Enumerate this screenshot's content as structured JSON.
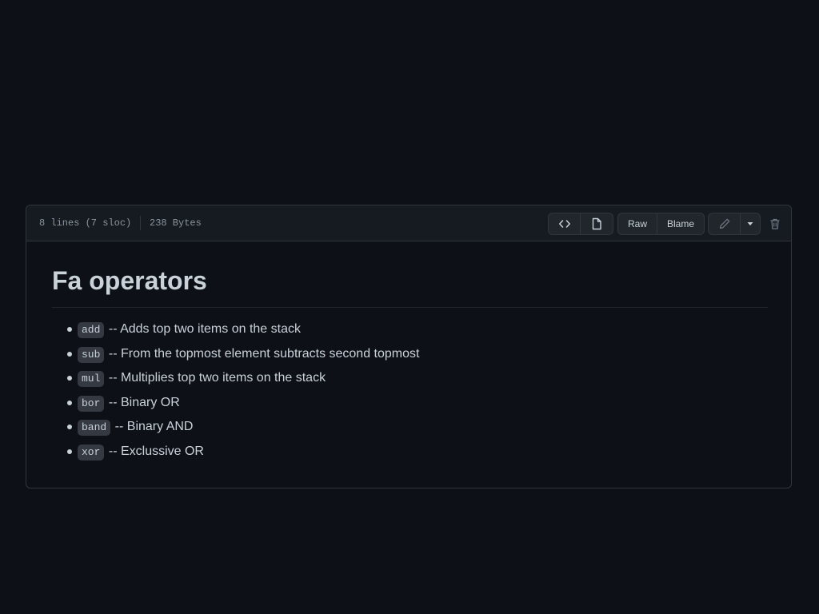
{
  "file_header": {
    "lines_info": "8 lines (7 sloc)",
    "size": "238 Bytes",
    "raw_label": "Raw",
    "blame_label": "Blame"
  },
  "document": {
    "title": "Fa operators",
    "operators": [
      {
        "code": "add",
        "desc": "-- Adds top two items on the stack"
      },
      {
        "code": "sub",
        "desc": "-- From the topmost element subtracts second topmost"
      },
      {
        "code": "mul",
        "desc": "-- Multiplies top two items on the stack"
      },
      {
        "code": "bor",
        "desc": "-- Binary OR"
      },
      {
        "code": "band",
        "desc": "-- Binary AND"
      },
      {
        "code": "xor",
        "desc": "-- Exclussive OR"
      }
    ]
  },
  "colors": {
    "page_background": "#0d1117",
    "header_background": "#161b22",
    "border": "#30363d",
    "text": "#c9d1d9",
    "muted_text": "#8b949e",
    "code_background": "#343942"
  },
  "icons": {
    "code": "code-icon",
    "preview": "file-icon",
    "edit": "pencil-icon",
    "menu": "triangle-down-icon",
    "delete": "trash-icon"
  }
}
